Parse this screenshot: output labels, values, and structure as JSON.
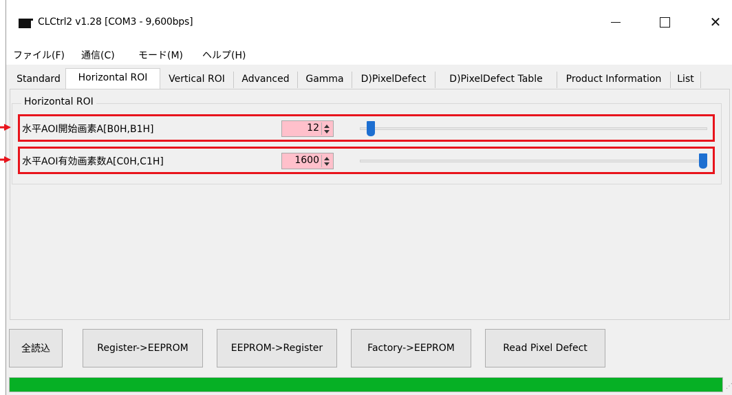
{
  "window": {
    "title": "CLCtrl2 v1.28  [COM3 - 9,600bps]"
  },
  "menu": [
    "ファイル(F)",
    "通信(C)",
    "モード(M)",
    "ヘルプ(H)"
  ],
  "tabs": [
    {
      "label": "Standard"
    },
    {
      "label": "Horizontal ROI",
      "active": true
    },
    {
      "label": "Vertical ROI"
    },
    {
      "label": "Advanced"
    },
    {
      "label": "Gamma"
    },
    {
      "label": "D)PixelDefect"
    },
    {
      "label": "D)PixelDefect Table"
    },
    {
      "label": "Product Information"
    },
    {
      "label": "List"
    }
  ],
  "group": {
    "title": "Horizontal ROI"
  },
  "params": [
    {
      "label": "水平AOI開始画素A[B0H,B1H]",
      "value": "12",
      "slider_fraction": 0.02
    },
    {
      "label": "水平AOI有効画素数A[C0H,C1H]",
      "value": "1600",
      "slider_fraction": 1.0
    }
  ],
  "buttons": {
    "read_all": "全読込",
    "register_to_eeprom": "Register->EEPROM",
    "eeprom_to_register": "EEPROM->Register",
    "factory_to_eeprom": "Factory->EEPROM",
    "read_pixel_defect": "Read Pixel Defect"
  },
  "progress": {
    "fraction": 1.0
  },
  "colors": {
    "highlight": "#e8141c",
    "value_bg": "#ffc0cb",
    "thumb": "#1d6fd1",
    "progress": "#06b025"
  },
  "icons": {
    "app": "app-icon",
    "minimize": "minimize-icon",
    "maximize": "maximize-icon",
    "close": "close-icon"
  }
}
